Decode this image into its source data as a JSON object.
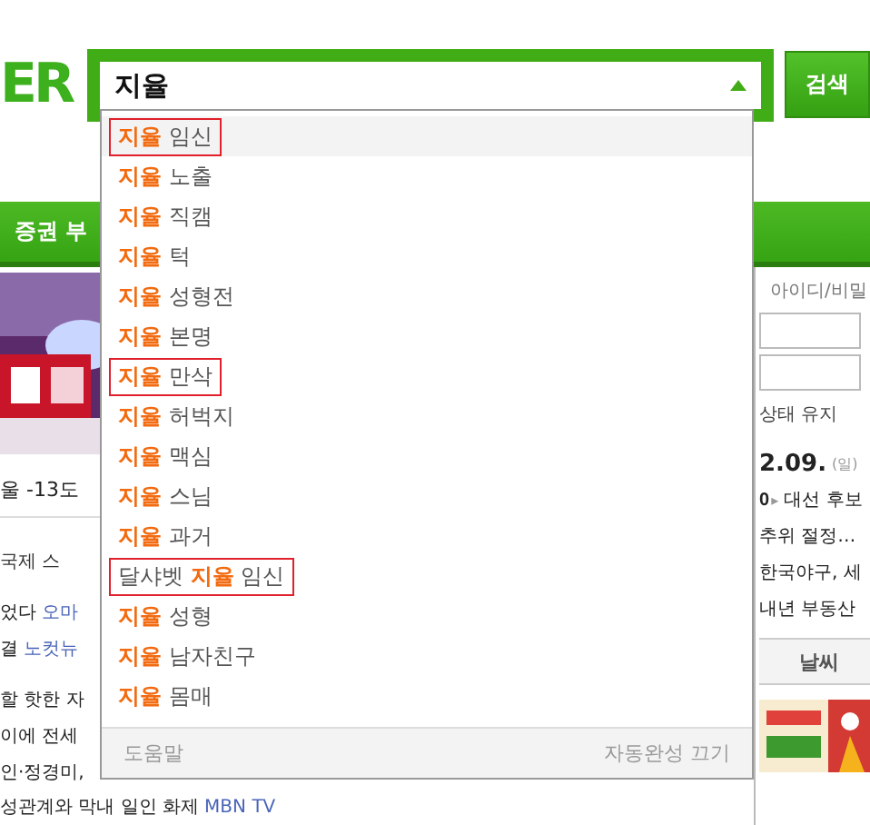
{
  "logo": "ER",
  "search": {
    "value": "지율",
    "button": "검색",
    "expanded": true
  },
  "nav": [
    "증권",
    "부"
  ],
  "left": {
    "weather": "울 -13도",
    "sections": [
      "국제",
      "스"
    ],
    "headlines": [
      {
        "text": "었다",
        "source": "오마"
      },
      {
        "text": "결",
        "source": "노컷뉴"
      }
    ],
    "lines": [
      "할 핫한 자",
      "이에 전세",
      "인·정경미,"
    ],
    "last": {
      "text": "성관계와 막내 일인 화제",
      "source": "MBN TV"
    }
  },
  "right": {
    "login_title": "아이디/비밀",
    "keep_login": "상태 유지",
    "date": "2.09.",
    "day": "(일)",
    "rank": "0",
    "arrow": "▸",
    "news": [
      "대선 후보",
      "추위 절정…",
      "한국야구, 세",
      "내년 부동산"
    ],
    "tab": "날씨"
  },
  "suggestions": [
    {
      "text": "**지율** 임신",
      "selected": true,
      "marked": true
    },
    {
      "text": "**지율** 노출",
      "selected": false,
      "marked": false
    },
    {
      "text": "**지율** 직캠",
      "selected": false,
      "marked": false
    },
    {
      "text": "**지율** 턱",
      "selected": false,
      "marked": false
    },
    {
      "text": "**지율** 성형전",
      "selected": false,
      "marked": false
    },
    {
      "text": "**지율** 본명",
      "selected": false,
      "marked": false
    },
    {
      "text": "**지율** 만삭",
      "selected": false,
      "marked": true
    },
    {
      "text": "**지율** 허벅지",
      "selected": false,
      "marked": false
    },
    {
      "text": "**지율** 맥심",
      "selected": false,
      "marked": false
    },
    {
      "text": "**지율** 스님",
      "selected": false,
      "marked": false
    },
    {
      "text": "**지율** 과거",
      "selected": false,
      "marked": false
    },
    {
      "text": "달샤벳 **지율** 임신",
      "selected": false,
      "marked": true
    },
    {
      "text": "**지율** 성형",
      "selected": false,
      "marked": false
    },
    {
      "text": "**지율** 남자친구",
      "selected": false,
      "marked": false
    },
    {
      "text": "**지율** 몸매",
      "selected": false,
      "marked": false
    }
  ],
  "footer": {
    "help": "도움말",
    "autocomplete_off": "자동완성 끄기"
  }
}
